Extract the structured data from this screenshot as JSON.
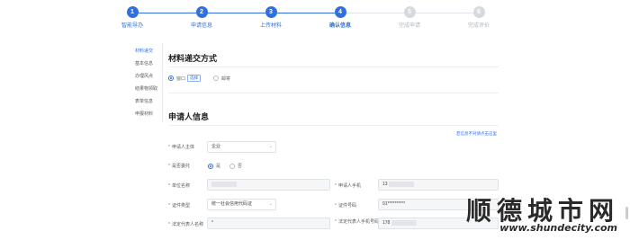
{
  "stepper": {
    "steps": [
      {
        "num": "1",
        "label": "智能导办",
        "state": "done"
      },
      {
        "num": "2",
        "label": "申请信息",
        "state": "done"
      },
      {
        "num": "3",
        "label": "上传材料",
        "state": "done"
      },
      {
        "num": "4",
        "label": "确认信息",
        "state": "current"
      },
      {
        "num": "5",
        "label": "完成申请",
        "state": "todo"
      },
      {
        "num": "6",
        "label": "完成评价",
        "state": "todo"
      }
    ]
  },
  "side_nav": {
    "items": [
      {
        "label": "材料递交",
        "active": true
      },
      {
        "label": "基本信息",
        "active": false
      },
      {
        "label": "办理风点",
        "active": false
      },
      {
        "label": "结果物领取",
        "active": false
      },
      {
        "label": "表单信息",
        "active": false
      },
      {
        "label": "申报材料",
        "active": false
      }
    ]
  },
  "delivery": {
    "title": "材料递交方式",
    "option_window": "窗口",
    "option_window_tag": "选择",
    "option_mail": "邮寄"
  },
  "applicant": {
    "title": "申请人信息",
    "top_link": "若信息不对请点击这里",
    "subject_label": "申请人主体",
    "subject_value": "企业",
    "proxy_label": "是否委托",
    "proxy_yes": "是",
    "proxy_no": "否",
    "unit_name_label": "单位名称",
    "phone_label": "申请人手机",
    "phone_value": "13",
    "id_type_label": "证件类型",
    "id_type_value": "统一社会信用代码证",
    "id_number_label": "证件号码",
    "id_number_value": "91**********",
    "legal_name_label": "法定代表人名称",
    "legal_name_value": "*",
    "legal_phone_label": "法定代表人手机号码",
    "legal_phone_value": "178"
  },
  "watermark": {
    "cn": "顺德城市网",
    "url": "www.shundecity.com"
  },
  "colors": {
    "primary": "#2f6fe0",
    "inactive": "#d5d9e0",
    "required": "#e05050"
  }
}
